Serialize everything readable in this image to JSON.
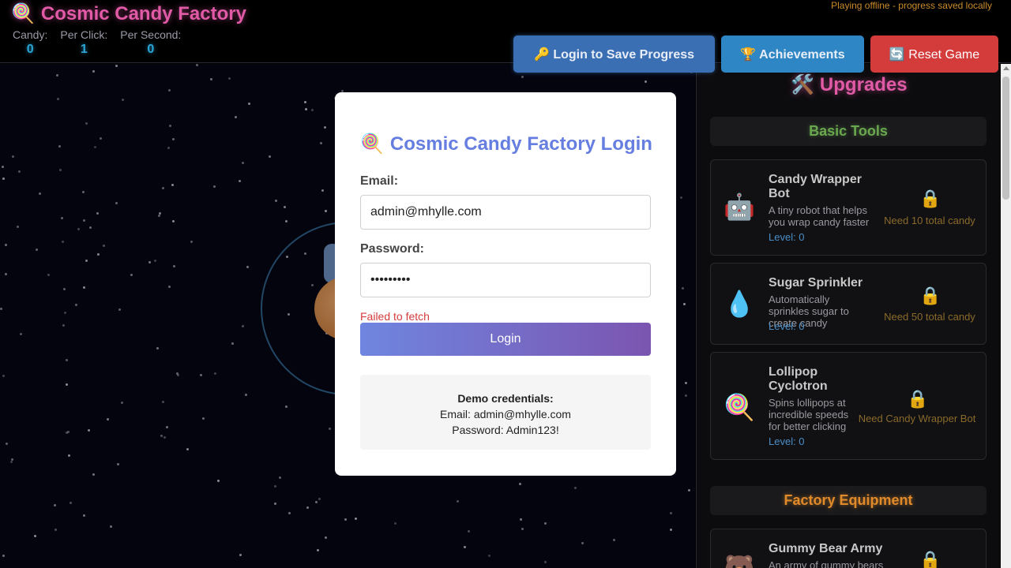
{
  "header": {
    "logo_emoji": "🍭",
    "title": "Cosmic Candy Factory",
    "offline_text": "Playing offline - progress saved locally",
    "stats": [
      {
        "label": "Candy:",
        "value": "0"
      },
      {
        "label": "Per Click:",
        "value": "1"
      },
      {
        "label": "Per Second:",
        "value": "0"
      }
    ],
    "buttons": {
      "login": "🔑 Login to Save Progress",
      "achievements": "🏆 Achievements",
      "reset": "🔄 Reset Game"
    }
  },
  "upgrades_panel": {
    "title": "🛠️ Upgrades",
    "categories": {
      "basic": "Basic Tools",
      "factory": "Factory Equipment"
    },
    "items": [
      {
        "icon": "🤖",
        "name": "Candy Wrapper Bot",
        "desc": "A tiny robot that helps you wrap candy faster",
        "level": "Level: 0",
        "lock": "🔒",
        "req": "Need 10 total candy"
      },
      {
        "icon": "💧",
        "name": "Sugar Sprinkler",
        "desc": "Automatically sprinkles sugar to create candy",
        "level": "Level: 0",
        "lock": "🔒",
        "req": "Need 50 total candy"
      },
      {
        "icon": "🍭",
        "name": "Lollipop Cyclotron",
        "desc": "Spins lollipops at incredible speeds for better clicking",
        "level": "Level: 0",
        "lock": "🔒",
        "req": "Need Candy Wrapper Bot"
      },
      {
        "icon": "🐻",
        "name": "Gummy Bear Army",
        "desc": "An army of gummy bears",
        "lock": "🔒"
      }
    ]
  },
  "login_modal": {
    "title_emoji": "🍭",
    "title": "Cosmic Candy Factory Login",
    "email_label": "Email:",
    "email_value": "admin@mhylle.com",
    "password_label": "Password:",
    "password_value": "•••••••••",
    "error": "Failed to fetch",
    "submit_label": "Login",
    "demo": {
      "title": "Demo credentials:",
      "email": "Email: admin@mhylle.com",
      "password": "Password: Admin123!"
    }
  }
}
